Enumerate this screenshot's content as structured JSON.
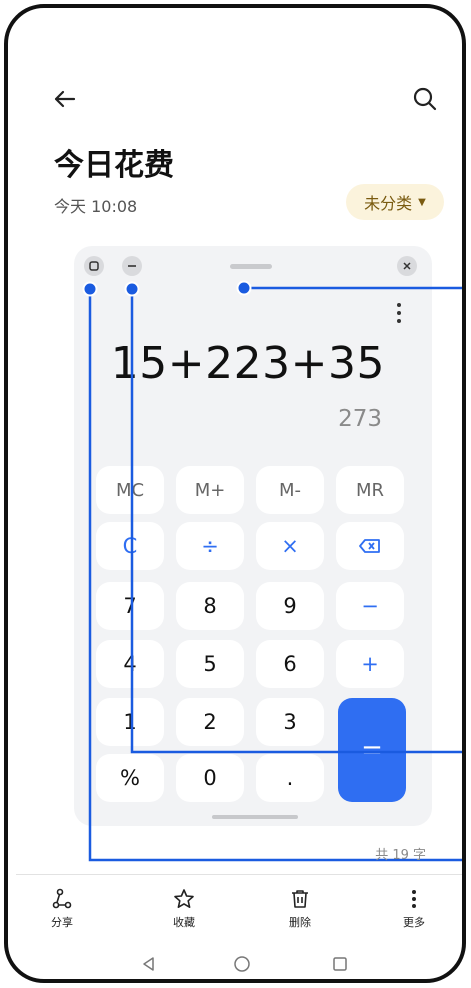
{
  "header": {
    "back_icon": "arrow-left-icon",
    "search_icon": "search-icon",
    "title": "今日花费",
    "time": "今天 10:08",
    "category_label": "未分类",
    "category_icon": "dropdown-triangle-icon"
  },
  "calculator": {
    "window_buttons": [
      "maximize-icon",
      "minimize-icon",
      "close-icon"
    ],
    "expression": "15+223+35",
    "result": "273",
    "memory_keys": [
      "MC",
      "M+",
      "M-",
      "MR"
    ],
    "ops_row": [
      "C",
      "÷",
      "×",
      "⌫"
    ],
    "row7": [
      "7",
      "8",
      "9",
      "−"
    ],
    "row4": [
      "4",
      "5",
      "6",
      "+"
    ],
    "row1": [
      "1",
      "2",
      "3"
    ],
    "row0": [
      "%",
      "0",
      "."
    ],
    "equals": "="
  },
  "note": {
    "word_count": "共 19 字"
  },
  "toolbar": {
    "share": "分享",
    "favorite": "收藏",
    "delete": "删除",
    "more": "更多"
  },
  "colors": {
    "accent": "#2f6ef2",
    "callout": "#1a5be0",
    "tag_bg": "#fbf3dc",
    "tag_text": "#7a5b10"
  }
}
